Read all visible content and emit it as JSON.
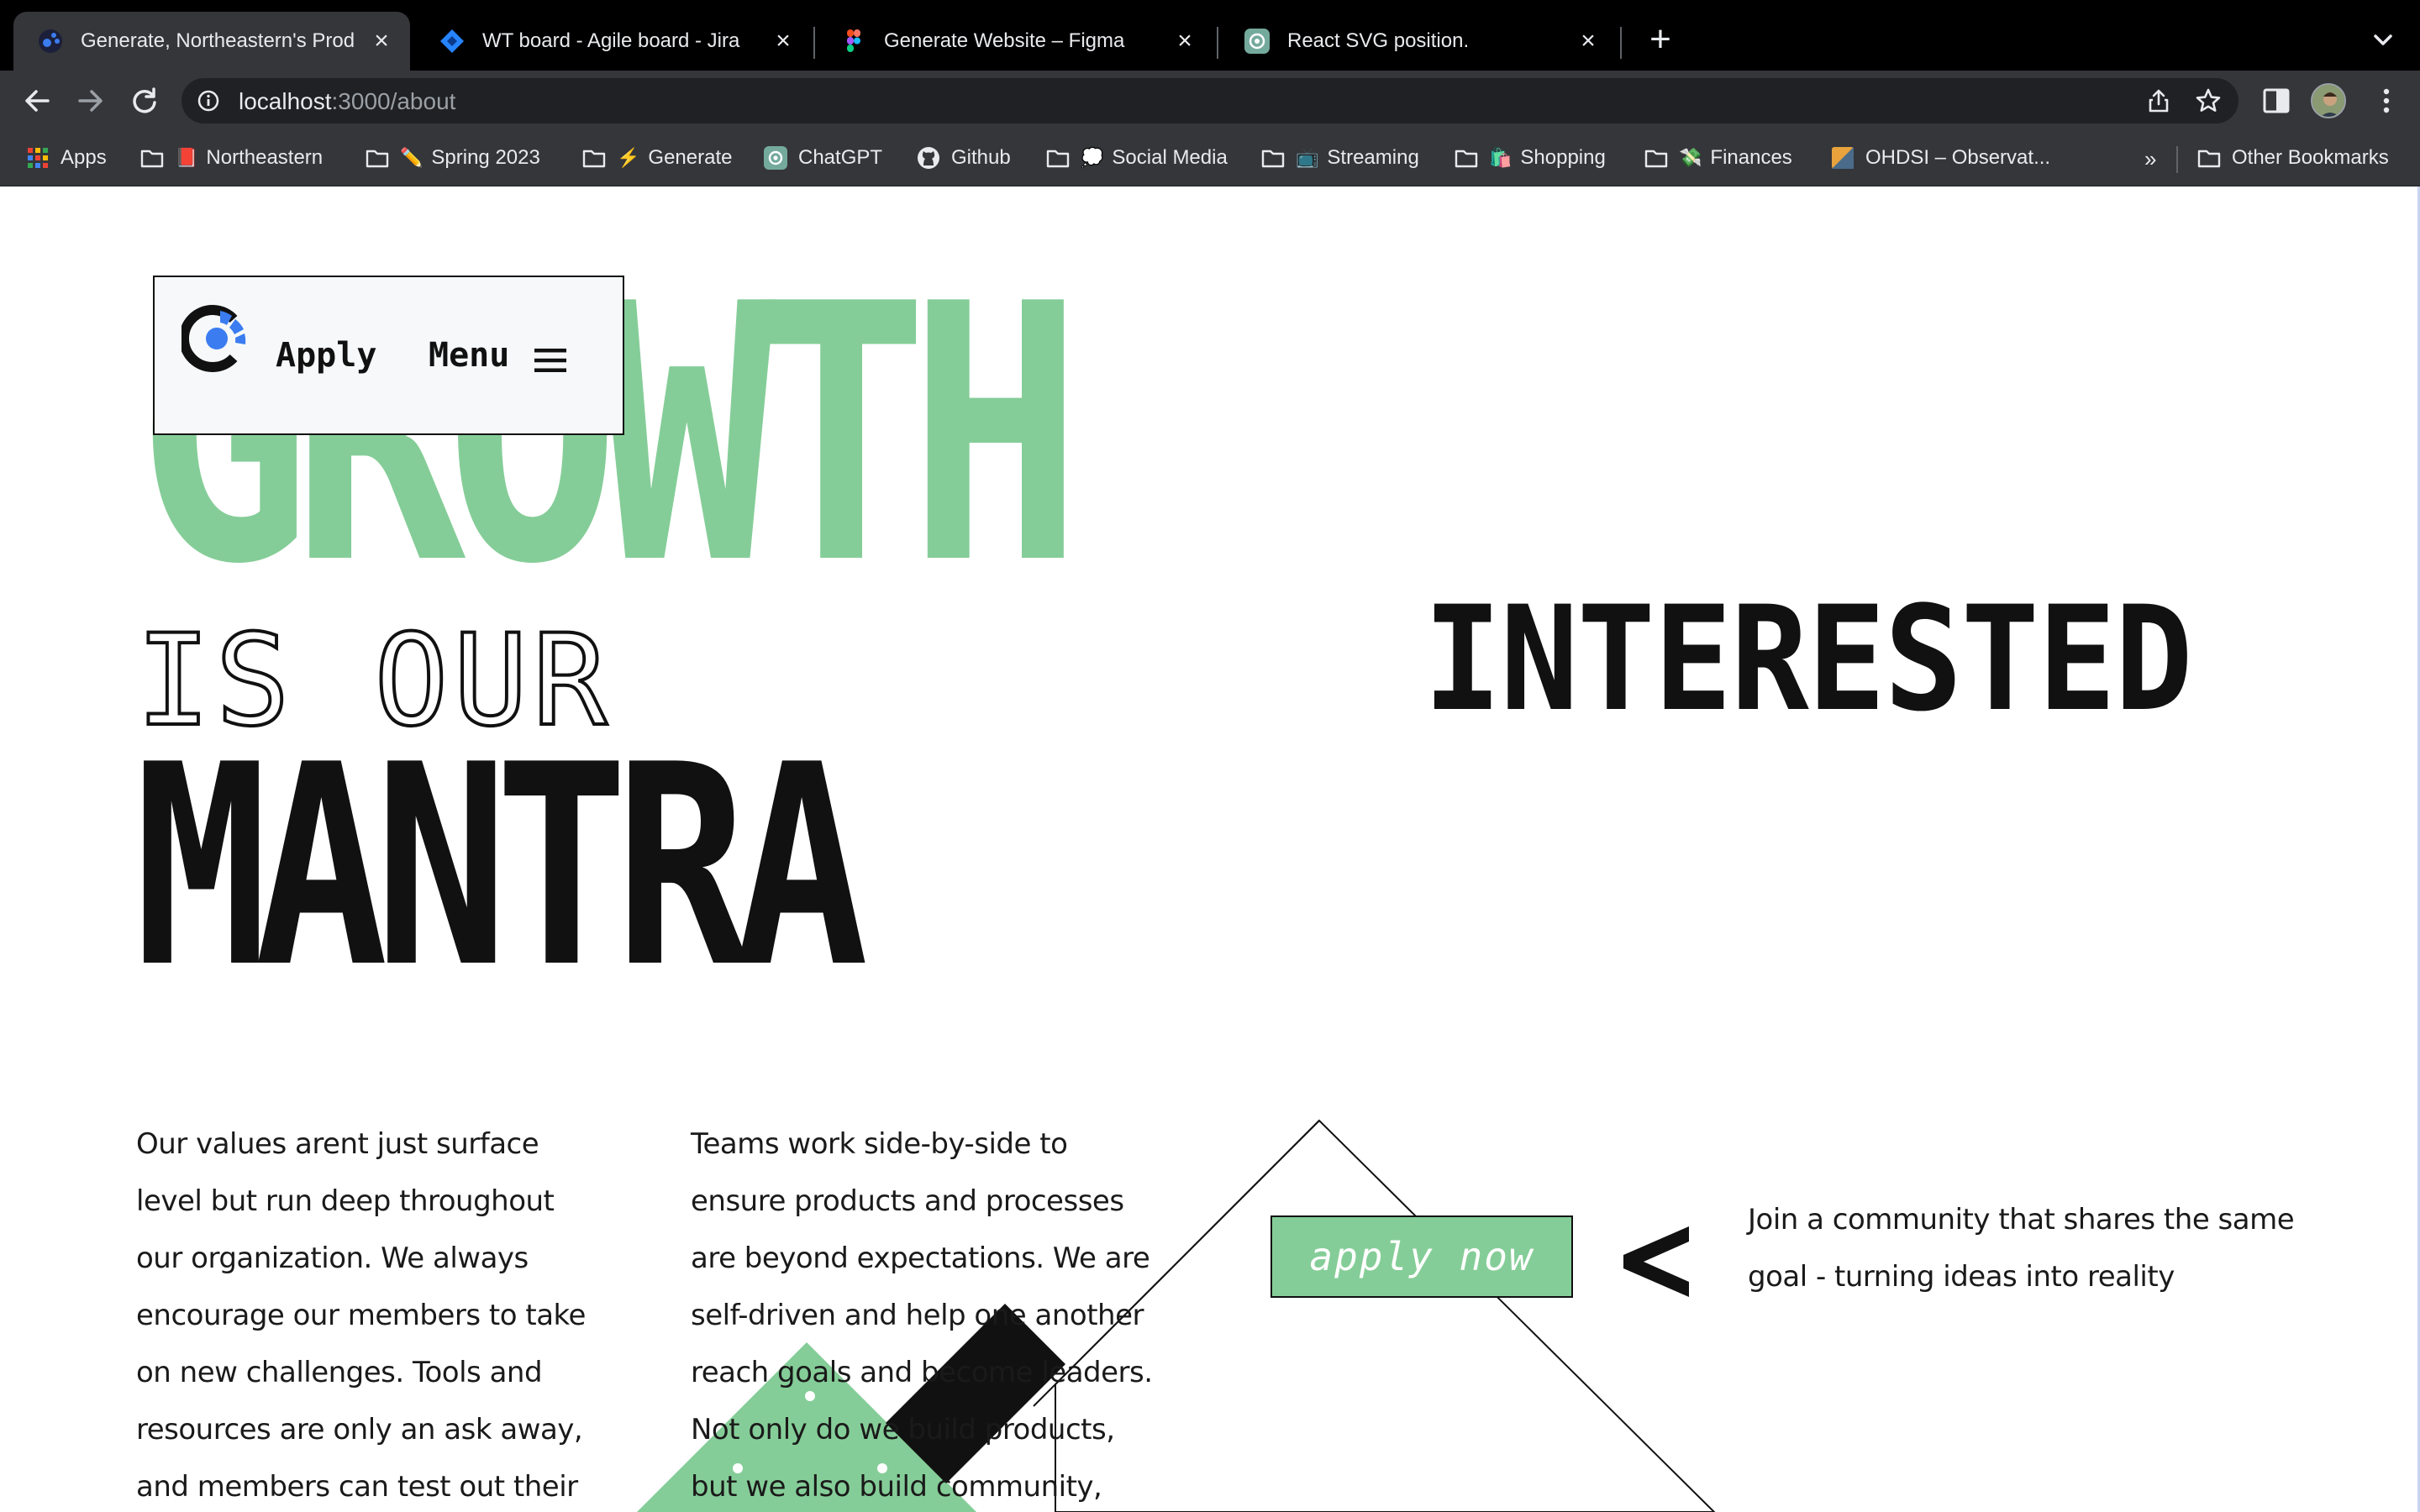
{
  "browser": {
    "tabs": [
      {
        "title": "Generate, Northeastern's Prod",
        "active": true,
        "icon": "generate-favicon"
      },
      {
        "title": "WT board - Agile board - Jira",
        "active": false,
        "icon": "jira-favicon"
      },
      {
        "title": "Generate Website – Figma",
        "active": false,
        "icon": "figma-favicon"
      },
      {
        "title": "React SVG position.",
        "active": false,
        "icon": "chatgpt-favicon"
      }
    ],
    "url_host": "localhost",
    "url_path": ":3000/about",
    "bookmarks": [
      {
        "label": "Apps",
        "icon": "apps-grid-icon"
      },
      {
        "label": "Northeastern",
        "icon": "folder-icon",
        "emoji": "📕"
      },
      {
        "label": "Spring 2023",
        "icon": "folder-icon",
        "emoji": "✏️"
      },
      {
        "label": "Generate",
        "icon": "folder-icon",
        "emoji": "⚡"
      },
      {
        "label": "ChatGPT",
        "icon": "chatgpt-icon"
      },
      {
        "label": "Github",
        "icon": "github-icon"
      },
      {
        "label": "Social Media",
        "icon": "folder-icon",
        "emoji": "💭"
      },
      {
        "label": "Streaming",
        "icon": "folder-icon",
        "emoji": "📺"
      },
      {
        "label": "Shopping",
        "icon": "folder-icon",
        "emoji": "🛍️"
      },
      {
        "label": "Finances",
        "icon": "folder-icon",
        "emoji": "💸"
      },
      {
        "label": "OHDSI – Observat...",
        "icon": "ohdsi-icon"
      }
    ],
    "more_bookmarks": "»",
    "other_bookmarks": "Other Bookmarks"
  },
  "nav": {
    "apply_label": "Apply",
    "menu_label": "Menu"
  },
  "hero": {
    "word1": "GROWTH",
    "word2": "IS OUR",
    "word3": "MANTRA",
    "side_word": "INTERESTED"
  },
  "colors": {
    "accent_green": "#85cd98",
    "ink": "#111111",
    "brand_blue": "#3b7cf0"
  },
  "content": {
    "para1": "Our values arent just surface level but run deep throughout our organization. We always encourage our members to take on new challenges. Tools and resources are only an ask away, and members can test out their",
    "para2": "Teams work side-by-side to ensure products and processes are beyond expectations. We are self-driven and help one another reach goals and become leaders. Not only do we build products, but we also build community,",
    "cta_label": "apply now",
    "cta_text": "Join a community that shares the same goal - turning ideas into reality"
  }
}
